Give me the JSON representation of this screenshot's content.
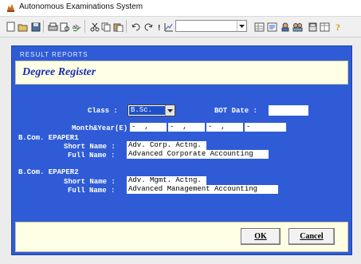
{
  "window": {
    "title": "Autonomous Examinations System"
  },
  "toolbar": {
    "icons": [
      "new-icon",
      "open-icon",
      "save-icon",
      "print-icon",
      "print-preview-icon",
      "spell-check-icon",
      "cut-icon",
      "copy-icon",
      "paste-icon",
      "undo-icon",
      "redo-icon",
      "bold-icon",
      "chart-icon",
      "grid-icon",
      "report-icon",
      "user-icon",
      "user-group-icon",
      "calculator-icon",
      "table-icon",
      "help-icon"
    ],
    "combo_value": ""
  },
  "dialog": {
    "section_header": "RESULT REPORTS",
    "title": "Degree Register",
    "class_label": "Class :",
    "class_value": "B.Sc.",
    "bot_date_label": "BOT Date :",
    "bot_date_value": "",
    "month_year_label": "Month&Year(E) :",
    "month_year_slots": [
      "-  ,",
      "-  ,",
      "-  ,",
      "-"
    ],
    "papers": [
      {
        "header": "B.Com. EPAPER1",
        "short_label": "Short Name :",
        "short_value": "Adv. Corp. Actng.",
        "full_label": "Full Name :",
        "full_value": "Advanced Corporate Accounting"
      },
      {
        "header": "B.Com. EPAPER2",
        "short_label": "Short Name :",
        "short_value": "Adv. Mgmt. Actng.",
        "full_label": "Full Name :",
        "full_value": "Advanced Management Accounting"
      }
    ],
    "ok_label": "OK",
    "cancel_label": "Cancel"
  },
  "colors": {
    "dialog_bg": "#2f5cd6",
    "panel_bg": "#ffffe6",
    "title_text": "#1b2cb0"
  }
}
